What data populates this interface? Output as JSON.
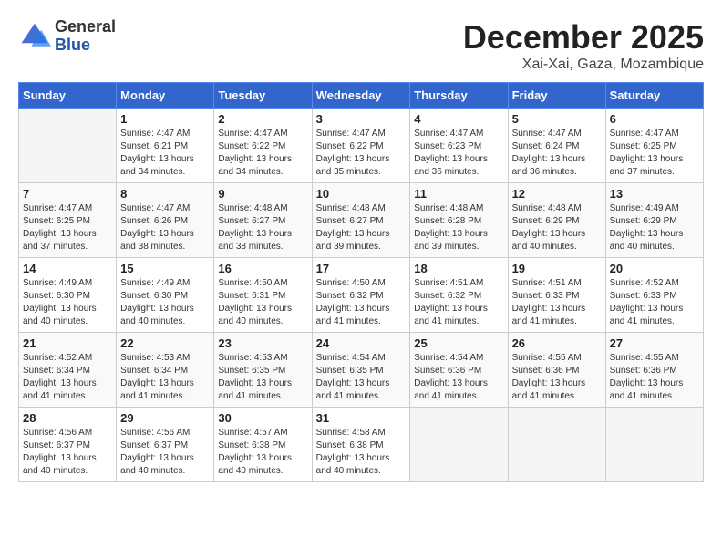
{
  "header": {
    "logo_general": "General",
    "logo_blue": "Blue",
    "month_title": "December 2025",
    "location": "Xai-Xai, Gaza, Mozambique"
  },
  "days_of_week": [
    "Sunday",
    "Monday",
    "Tuesday",
    "Wednesday",
    "Thursday",
    "Friday",
    "Saturday"
  ],
  "weeks": [
    [
      {
        "day": "",
        "info": ""
      },
      {
        "day": "1",
        "info": "Sunrise: 4:47 AM\nSunset: 6:21 PM\nDaylight: 13 hours and 34 minutes."
      },
      {
        "day": "2",
        "info": "Sunrise: 4:47 AM\nSunset: 6:22 PM\nDaylight: 13 hours and 34 minutes."
      },
      {
        "day": "3",
        "info": "Sunrise: 4:47 AM\nSunset: 6:22 PM\nDaylight: 13 hours and 35 minutes."
      },
      {
        "day": "4",
        "info": "Sunrise: 4:47 AM\nSunset: 6:23 PM\nDaylight: 13 hours and 36 minutes."
      },
      {
        "day": "5",
        "info": "Sunrise: 4:47 AM\nSunset: 6:24 PM\nDaylight: 13 hours and 36 minutes."
      },
      {
        "day": "6",
        "info": "Sunrise: 4:47 AM\nSunset: 6:25 PM\nDaylight: 13 hours and 37 minutes."
      }
    ],
    [
      {
        "day": "7",
        "info": "Sunrise: 4:47 AM\nSunset: 6:25 PM\nDaylight: 13 hours and 37 minutes."
      },
      {
        "day": "8",
        "info": "Sunrise: 4:47 AM\nSunset: 6:26 PM\nDaylight: 13 hours and 38 minutes."
      },
      {
        "day": "9",
        "info": "Sunrise: 4:48 AM\nSunset: 6:27 PM\nDaylight: 13 hours and 38 minutes."
      },
      {
        "day": "10",
        "info": "Sunrise: 4:48 AM\nSunset: 6:27 PM\nDaylight: 13 hours and 39 minutes."
      },
      {
        "day": "11",
        "info": "Sunrise: 4:48 AM\nSunset: 6:28 PM\nDaylight: 13 hours and 39 minutes."
      },
      {
        "day": "12",
        "info": "Sunrise: 4:48 AM\nSunset: 6:29 PM\nDaylight: 13 hours and 40 minutes."
      },
      {
        "day": "13",
        "info": "Sunrise: 4:49 AM\nSunset: 6:29 PM\nDaylight: 13 hours and 40 minutes."
      }
    ],
    [
      {
        "day": "14",
        "info": "Sunrise: 4:49 AM\nSunset: 6:30 PM\nDaylight: 13 hours and 40 minutes."
      },
      {
        "day": "15",
        "info": "Sunrise: 4:49 AM\nSunset: 6:30 PM\nDaylight: 13 hours and 40 minutes."
      },
      {
        "day": "16",
        "info": "Sunrise: 4:50 AM\nSunset: 6:31 PM\nDaylight: 13 hours and 40 minutes."
      },
      {
        "day": "17",
        "info": "Sunrise: 4:50 AM\nSunset: 6:32 PM\nDaylight: 13 hours and 41 minutes."
      },
      {
        "day": "18",
        "info": "Sunrise: 4:51 AM\nSunset: 6:32 PM\nDaylight: 13 hours and 41 minutes."
      },
      {
        "day": "19",
        "info": "Sunrise: 4:51 AM\nSunset: 6:33 PM\nDaylight: 13 hours and 41 minutes."
      },
      {
        "day": "20",
        "info": "Sunrise: 4:52 AM\nSunset: 6:33 PM\nDaylight: 13 hours and 41 minutes."
      }
    ],
    [
      {
        "day": "21",
        "info": "Sunrise: 4:52 AM\nSunset: 6:34 PM\nDaylight: 13 hours and 41 minutes."
      },
      {
        "day": "22",
        "info": "Sunrise: 4:53 AM\nSunset: 6:34 PM\nDaylight: 13 hours and 41 minutes."
      },
      {
        "day": "23",
        "info": "Sunrise: 4:53 AM\nSunset: 6:35 PM\nDaylight: 13 hours and 41 minutes."
      },
      {
        "day": "24",
        "info": "Sunrise: 4:54 AM\nSunset: 6:35 PM\nDaylight: 13 hours and 41 minutes."
      },
      {
        "day": "25",
        "info": "Sunrise: 4:54 AM\nSunset: 6:36 PM\nDaylight: 13 hours and 41 minutes."
      },
      {
        "day": "26",
        "info": "Sunrise: 4:55 AM\nSunset: 6:36 PM\nDaylight: 13 hours and 41 minutes."
      },
      {
        "day": "27",
        "info": "Sunrise: 4:55 AM\nSunset: 6:36 PM\nDaylight: 13 hours and 41 minutes."
      }
    ],
    [
      {
        "day": "28",
        "info": "Sunrise: 4:56 AM\nSunset: 6:37 PM\nDaylight: 13 hours and 40 minutes."
      },
      {
        "day": "29",
        "info": "Sunrise: 4:56 AM\nSunset: 6:37 PM\nDaylight: 13 hours and 40 minutes."
      },
      {
        "day": "30",
        "info": "Sunrise: 4:57 AM\nSunset: 6:38 PM\nDaylight: 13 hours and 40 minutes."
      },
      {
        "day": "31",
        "info": "Sunrise: 4:58 AM\nSunset: 6:38 PM\nDaylight: 13 hours and 40 minutes."
      },
      {
        "day": "",
        "info": ""
      },
      {
        "day": "",
        "info": ""
      },
      {
        "day": "",
        "info": ""
      }
    ]
  ]
}
